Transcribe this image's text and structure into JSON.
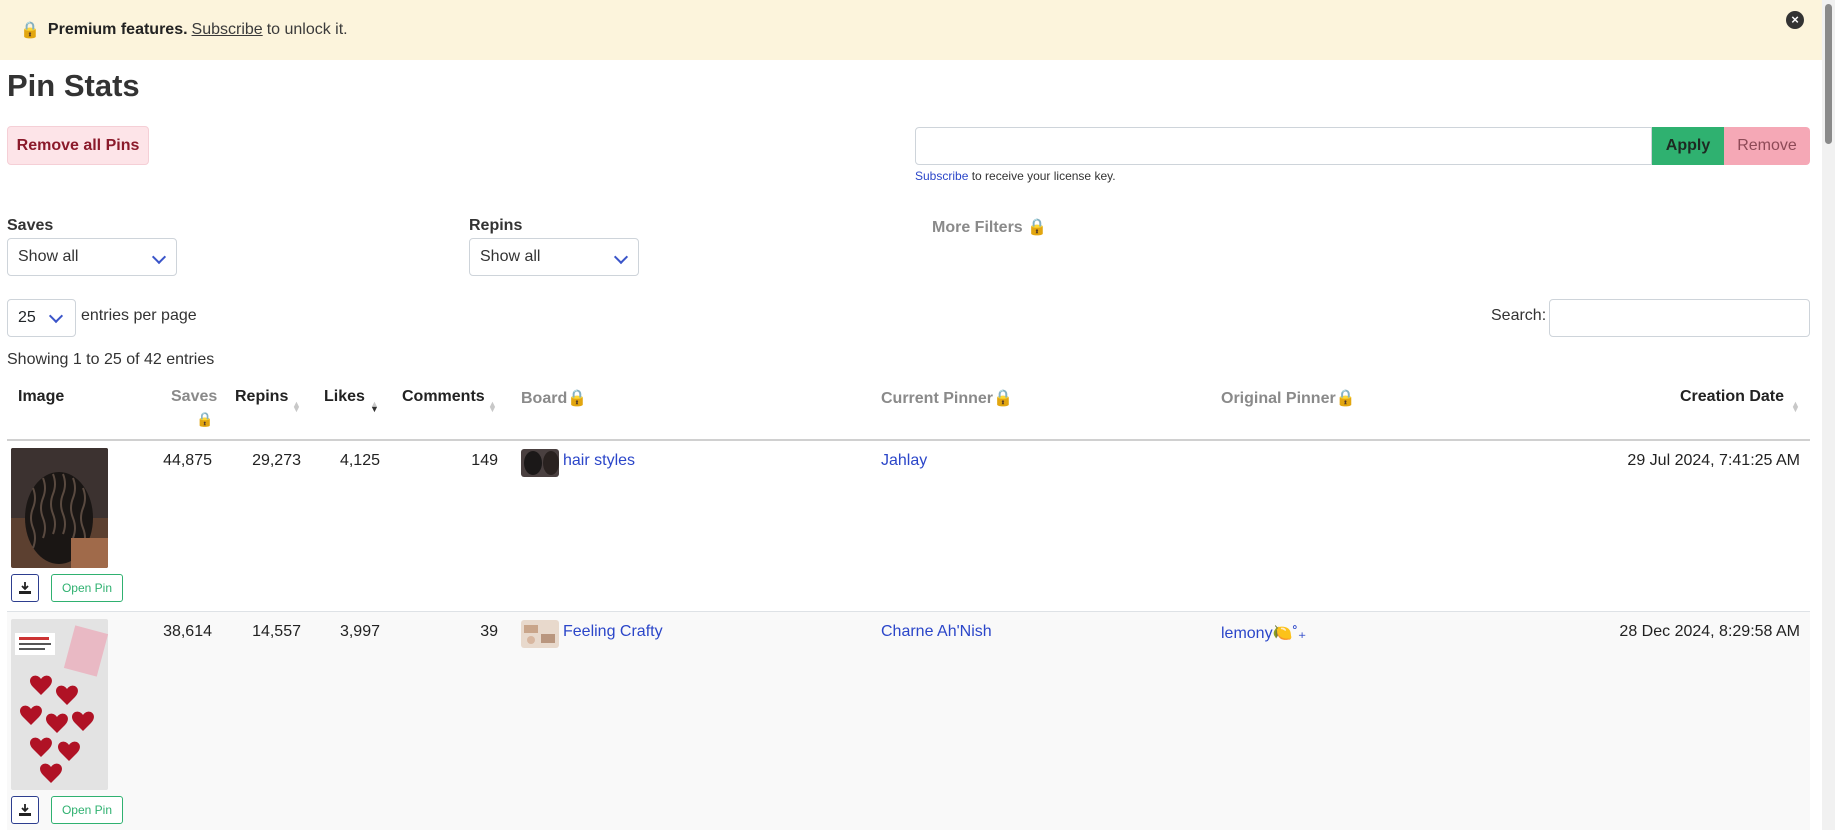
{
  "banner": {
    "lock_icon": "🔒",
    "bold_text": "Premium features.",
    "link_text": "Subscribe",
    "suffix": "to unlock it."
  },
  "page_title": "Pin Stats",
  "actions": {
    "remove_all_label": "Remove all Pins",
    "apply_label": "Apply",
    "remove_label": "Remove",
    "license_link": "Subscribe",
    "license_note": "to receive your license key."
  },
  "filters": {
    "saves_label": "Saves",
    "saves_value": "Show all",
    "repins_label": "Repins",
    "repins_value": "Show all",
    "more_filters_label": "More Filters 🔒"
  },
  "table_controls": {
    "entries_value": "25",
    "entries_text": "entries per page",
    "search_label": "Search:",
    "showing_text": "Showing 1 to 25 of 42 entries"
  },
  "columns": {
    "image": "Image",
    "saves": "Saves",
    "repins": "Repins",
    "likes": "Likes",
    "comments": "Comments",
    "board": "Board🔒",
    "current_pinner": "Current Pinner🔒",
    "original_pinner": "Original Pinner🔒",
    "creation_date": "Creation Date",
    "lock": "🔒"
  },
  "rows": [
    {
      "saves": "44,875",
      "repins": "29,273",
      "likes": "4,125",
      "comments": "149",
      "board": "hair styles",
      "current_pinner": "Jahlay",
      "original_pinner": "",
      "creation_date": "29 Jul 2024, 7:41:25 AM",
      "open_label": "Open Pin"
    },
    {
      "saves": "38,614",
      "repins": "14,557",
      "likes": "3,997",
      "comments": "39",
      "board": "Feeling Crafty",
      "current_pinner": "Charne Ah'Nish",
      "original_pinner": "lemony🍋˚₊",
      "creation_date": "28 Dec 2024, 8:29:58 AM",
      "open_label": "Open Pin"
    }
  ],
  "colors": {
    "banner_bg": "#fcf4dc",
    "link": "#2b46c9",
    "apply_green": "#2fb170",
    "remove_pink": "#f5a8b6"
  }
}
